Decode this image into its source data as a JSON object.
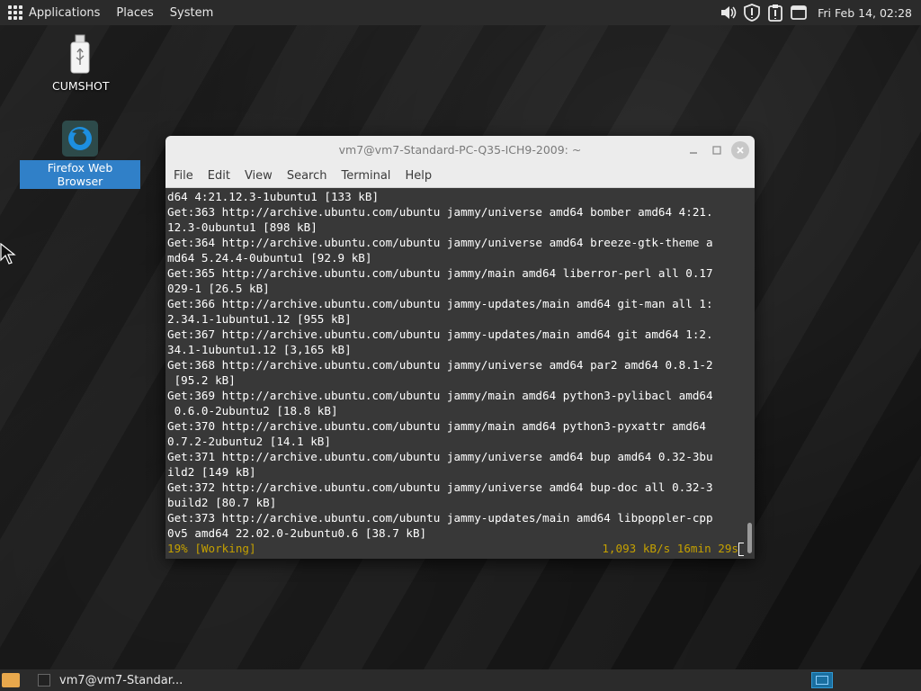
{
  "top_panel": {
    "menus": [
      "Applications",
      "Places",
      "System"
    ],
    "tray_icons": [
      "volume-icon",
      "shield-icon",
      "clipboard-alert-icon",
      "window-icon"
    ],
    "clock": "Fri Feb 14, 02:28"
  },
  "desktop": {
    "icons": [
      {
        "label": "CUMSHOT",
        "icon": "usb-drive-icon",
        "selected": false
      },
      {
        "label": "Firefox Web Browser",
        "icon": "firefox-icon",
        "selected": true
      }
    ]
  },
  "terminal": {
    "title": "vm7@vm7-Standard-PC-Q35-ICH9-2009: ~",
    "menu": [
      "File",
      "Edit",
      "View",
      "Search",
      "Terminal",
      "Help"
    ],
    "lines": [
      "d64 4:21.12.3-1ubuntu1 [133 kB]",
      "Get:363 http://archive.ubuntu.com/ubuntu jammy/universe amd64 bomber amd64 4:21.",
      "12.3-0ubuntu1 [898 kB]",
      "Get:364 http://archive.ubuntu.com/ubuntu jammy/universe amd64 breeze-gtk-theme a",
      "md64 5.24.4-0ubuntu1 [92.9 kB]",
      "Get:365 http://archive.ubuntu.com/ubuntu jammy/main amd64 liberror-perl all 0.17",
      "029-1 [26.5 kB]",
      "Get:366 http://archive.ubuntu.com/ubuntu jammy-updates/main amd64 git-man all 1:",
      "2.34.1-1ubuntu1.12 [955 kB]",
      "Get:367 http://archive.ubuntu.com/ubuntu jammy-updates/main amd64 git amd64 1:2.",
      "34.1-1ubuntu1.12 [3,165 kB]",
      "Get:368 http://archive.ubuntu.com/ubuntu jammy/universe amd64 par2 amd64 0.8.1-2",
      " [95.2 kB]",
      "Get:369 http://archive.ubuntu.com/ubuntu jammy/main amd64 python3-pylibacl amd64",
      " 0.6.0-2ubuntu2 [18.8 kB]",
      "Get:370 http://archive.ubuntu.com/ubuntu jammy/main amd64 python3-pyxattr amd64 ",
      "0.7.2-2ubuntu2 [14.1 kB]",
      "Get:371 http://archive.ubuntu.com/ubuntu jammy/universe amd64 bup amd64 0.32-3bu",
      "ild2 [149 kB]",
      "Get:372 http://archive.ubuntu.com/ubuntu jammy/universe amd64 bup-doc all 0.32-3",
      "build2 [80.7 kB]",
      "Get:373 http://archive.ubuntu.com/ubuntu jammy-updates/main amd64 libpoppler-cpp",
      "0v5 amd64 22.02.0-2ubuntu0.6 [38.7 kB]"
    ],
    "status_left": "19% [Working]",
    "status_right": "1,093 kB/s 16min 29s"
  },
  "bottom_panel": {
    "task_label": "vm7@vm7-Standar..."
  },
  "colors": {
    "status_text": "#c4a000",
    "selection": "#3080c8",
    "terminal_bg": "#383838"
  }
}
